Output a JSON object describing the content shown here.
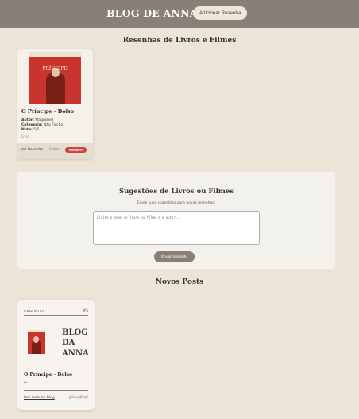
{
  "header": {
    "brand": "BLOG DE ANNA",
    "add_button": "Adicionar Resenha"
  },
  "reviews": {
    "title": "Resenhas de Livros e Filmes",
    "items": [
      {
        "cover_title": "PRÍNCIPE",
        "title": "O Príncipe - Bolso",
        "author_label": "Autor:",
        "author": "Maquiavel",
        "category_label": "Categoria:",
        "category": "Não Ficção",
        "rating_label": "Nota:",
        "rating": "5/5",
        "date": "Livro",
        "view_label": "Ver Resenha",
        "edit_label": "Editar",
        "remove_label": "Remover"
      }
    ]
  },
  "suggestions": {
    "title": "Sugestões de Livros ou Filmes",
    "subtitle": "Envie suas sugestões para novas resenhas:",
    "placeholder": "Digite o nome do livro ou filme e o autor...",
    "send_label": "Enviar Sugestão"
  },
  "posts": {
    "title": "Novos Posts",
    "items": [
      {
        "label": "NEW POST",
        "number": "#5",
        "brand_line1": "BLOG",
        "brand_line2": "DA",
        "brand_line3": "ANNA",
        "title": "O Príncipe - Bolso",
        "excerpt": "a...",
        "link": "leia mais no blog",
        "handle": "@leanfippi"
      }
    ]
  },
  "colors": {
    "header_bg": "#8a7f78",
    "page_bg": "#ede4d8",
    "remove_button": "#c8473f",
    "book_cover": "#c8352c"
  }
}
